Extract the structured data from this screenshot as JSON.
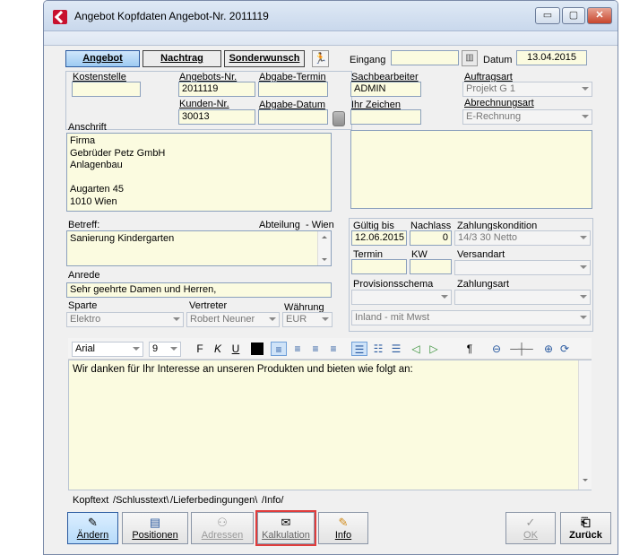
{
  "window": {
    "title": "Angebot Kopfdaten Angebot-Nr. 2011119",
    "min_label": "▭",
    "max_label": "▢",
    "close_label": "✕"
  },
  "tabs": [
    {
      "label": "Angebot"
    },
    {
      "label": "Nachtrag"
    },
    {
      "label": "Sonderwunsch"
    }
  ],
  "header": {
    "eingang_label": "Eingang",
    "eingang_value": "",
    "datum_label": "Datum",
    "datum_value": "13.04.2015"
  },
  "form": {
    "kostenstelle_label": "Kostenstelle",
    "kostenstelle_value": "",
    "angebots_nr_label": "Angebots-Nr.",
    "angebots_nr_value": "2011119",
    "abgabe_termin_label": "Abgabe-Termin",
    "abgabe_termin_value": "",
    "kunden_nr_label": "Kunden-Nr.",
    "kunden_nr_value": "30013",
    "abgabe_datum_label": "Abgabe-Datum",
    "abgabe_datum_value": "",
    "sachbearbeiter_label": "Sachbearbeiter",
    "sachbearbeiter_value": "ADMIN",
    "ihr_zeichen_label": "Ihr Zeichen",
    "ihr_zeichen_value": "",
    "auftragsart_label": "Auftragsart",
    "auftragsart_value": "Projekt G 1",
    "abrechnungsart_label": "Abrechnungsart",
    "abrechnungsart_value": "E-Rechnung",
    "anschrift_label": "Anschrift",
    "anschrift_value": "Firma\nGebrüder Petz GmbH\nAnlagenbau\n\nAugarten 45\n1010 Wien",
    "betreff_label": "Betreff:",
    "abteilung_label": "Abteilung",
    "abteilung_value": "- Wien",
    "betreff_value": "Sanierung Kindergarten",
    "anrede_label": "Anrede",
    "anrede_value": "Sehr geehrte Damen und Herren,",
    "sparte_label": "Sparte",
    "sparte_value": "Elektro",
    "vertreter_label": "Vertreter",
    "vertreter_value": "Robert Neuner",
    "waehrung_label": "Währung",
    "waehrung_value": "EUR"
  },
  "conditions": {
    "gueltig_bis_label": "Gültig bis",
    "gueltig_bis_value": "12.06.2015",
    "nachlass_label": "Nachlass",
    "nachlass_value": "0",
    "zahlungskondition_label": "Zahlungskondition",
    "zahlungskondition_value": "14/3 30 Netto",
    "termin_label": "Termin",
    "termin_value": "",
    "kw_label": "KW",
    "kw_value": "",
    "versandart_label": "Versandart",
    "versandart_value": "",
    "provisionsschema_label": "Provisionsschema",
    "provisionsschema_value": "",
    "zahlungsart_label": "Zahlungsart",
    "zahlungsart_value": "",
    "steuer_value": "Inland - mit Mwst"
  },
  "editor": {
    "font_name": "Arial",
    "font_size": "9",
    "bold_label": "F",
    "italic_label": "K",
    "underline_label": "U",
    "paragraph_label": "¶",
    "text": "Wir danken für Ihr Interesse an unseren Produkten und bieten wie folgt an:"
  },
  "bottom_tabs": [
    {
      "label": "Kopftext"
    },
    {
      "label": "Schlusstext"
    },
    {
      "label": "Lieferbedingungen"
    },
    {
      "label": "Info"
    }
  ],
  "buttons": {
    "aendern": "Ändern",
    "positionen": "Positionen",
    "adressen": "Adressen",
    "kalkulation": "Kalkulation",
    "info": "Info",
    "ok": "OK",
    "zurueck": "Zurück"
  }
}
